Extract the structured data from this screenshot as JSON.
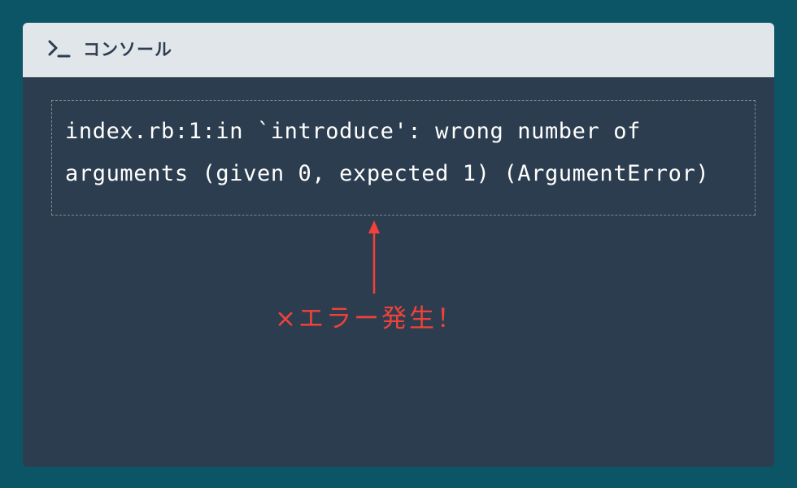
{
  "console": {
    "title": "コンソール",
    "icon": "terminal-prompt-icon",
    "error_message": "index.rb:1:in `introduce': wrong number of\narguments (given 0, expected 1) (ArgumentError)"
  },
  "annotation": {
    "label": "×エラー発生！",
    "color": "#f0423a"
  },
  "colors": {
    "background": "#0b5566",
    "console_body": "#2c3d4f",
    "titlebar": "#e0e6ea",
    "text": "#ffffff"
  }
}
